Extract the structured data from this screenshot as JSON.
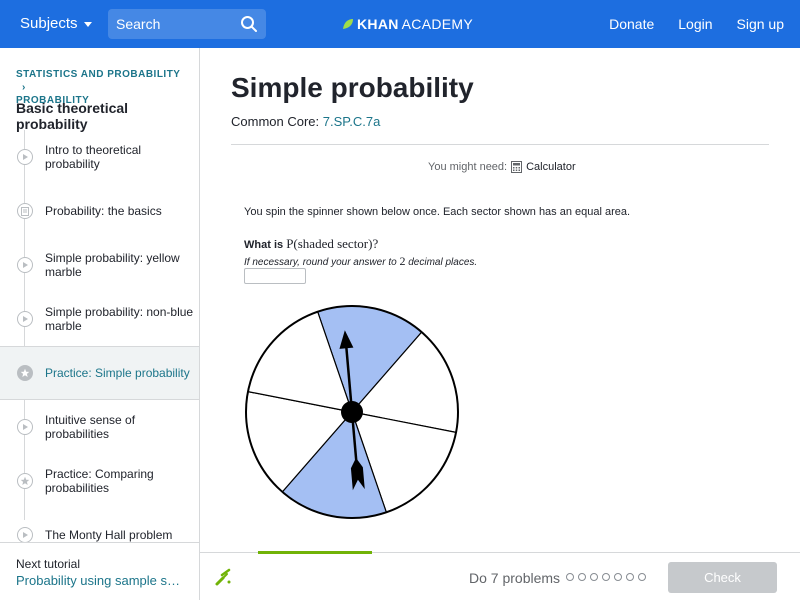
{
  "topnav": {
    "subjects_label": "Subjects",
    "search_placeholder": "Search",
    "logo_bold": "KHAN",
    "logo_light": "ACADEMY",
    "donate": "Donate",
    "login": "Login",
    "signup": "Sign up"
  },
  "sidebar": {
    "breadcrumb_line1": "STATISTICS AND PROBABILITY",
    "breadcrumb_line2": "PROBABILITY",
    "title": "Basic theoretical probability",
    "items": [
      {
        "label": "Intro to theoretical probability",
        "icon": "play-icon"
      },
      {
        "label": "Probability: the basics",
        "icon": "article-icon"
      },
      {
        "label": "Simple probability: yellow marble",
        "icon": "play-icon"
      },
      {
        "label": "Simple probability: non-blue marble",
        "icon": "play-icon"
      },
      {
        "label": "Practice: Simple probability",
        "icon": "star-icon",
        "active": true
      },
      {
        "label": "Intuitive sense of probabilities",
        "icon": "play-icon"
      },
      {
        "label": "Practice: Comparing probabilities",
        "icon": "star-icon"
      },
      {
        "label": "The Monty Hall problem",
        "icon": "play-icon"
      }
    ],
    "next_label": "Next tutorial",
    "next_link": "Probability using sample spaces"
  },
  "main": {
    "title": "Simple probability",
    "common_core_label": "Common Core:",
    "common_core_code": "7.SP.C.7a",
    "might_need": "You might need:",
    "calculator": "Calculator",
    "question_line1": "You spin the spinner shown below once. Each sector shown has an equal area.",
    "what_is": "What is",
    "prob_expr": "P(shaded sector)?",
    "round_note_prefix": "If necessary, round your answer to",
    "round_note_num": "2",
    "round_note_suffix": "decimal places.",
    "answer_value": ""
  },
  "spinner": {
    "sector_count": 6,
    "shaded_sectors": [
      0,
      3
    ],
    "shade_color": "#a4bff3",
    "arrow_direction": "up"
  },
  "bottombar": {
    "do_label": "Do 7 problems",
    "problem_count": 7,
    "check_label": "Check"
  },
  "colors": {
    "nav": "#1d6ee0",
    "link": "#1c758a",
    "progress": "#71b307"
  }
}
